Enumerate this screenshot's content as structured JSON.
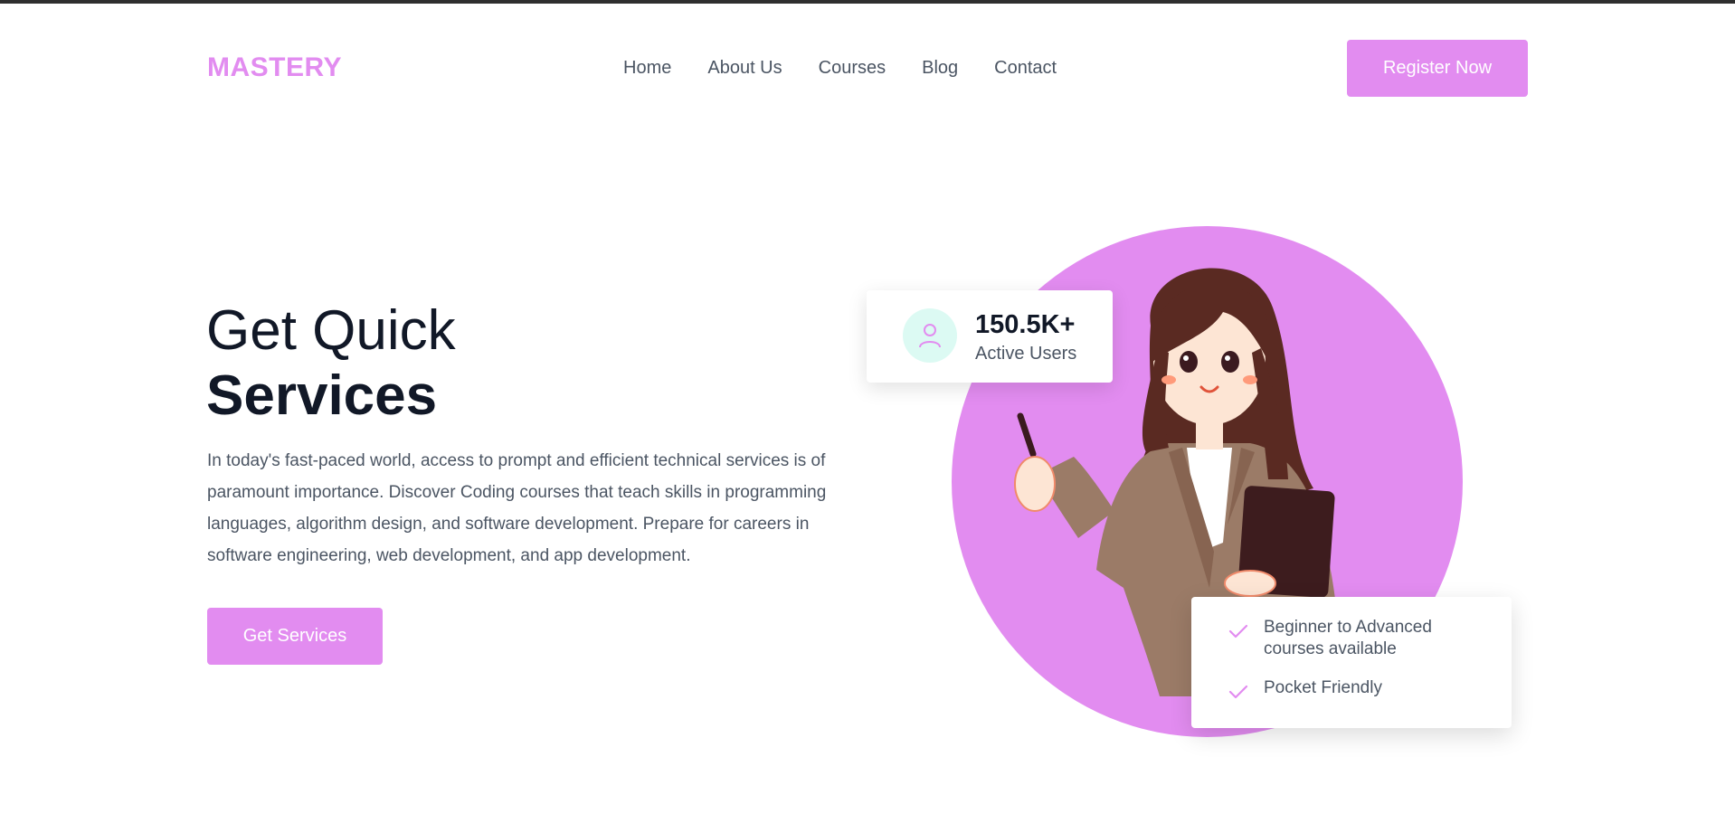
{
  "brand": {
    "name": "MASTERY",
    "accent_color": "#e28cf0"
  },
  "nav": {
    "items": [
      {
        "label": "Home"
      },
      {
        "label": "About Us"
      },
      {
        "label": "Courses"
      },
      {
        "label": "Blog"
      },
      {
        "label": "Contact"
      }
    ]
  },
  "header": {
    "register_label": "Register Now"
  },
  "hero": {
    "title_line1": "Get Quick",
    "title_line2": "Services",
    "description": "In today's fast-paced world, access to prompt and efficient technical services is of paramount importance. Discover Coding courses that teach skills in programming languages, algorithm design, and software development. Prepare for careers in software engineering, web development, and app development.",
    "cta_label": "Get Services"
  },
  "stats": {
    "value": "150.5K+",
    "label": "Active Users",
    "icon": "user-icon",
    "icon_bg": "#dcfaf3"
  },
  "features": {
    "items": [
      {
        "text": "Beginner to Advanced courses available",
        "icon": "check-icon"
      },
      {
        "text": "Pocket Friendly",
        "icon": "check-icon"
      }
    ]
  },
  "colors": {
    "accent": "#e28cf0",
    "heading": "#111827",
    "body_text": "#4b5563",
    "top_strip": "#2f2f2f"
  },
  "illustration": {
    "subject": "woman-with-pen-and-tablet-illustration"
  }
}
